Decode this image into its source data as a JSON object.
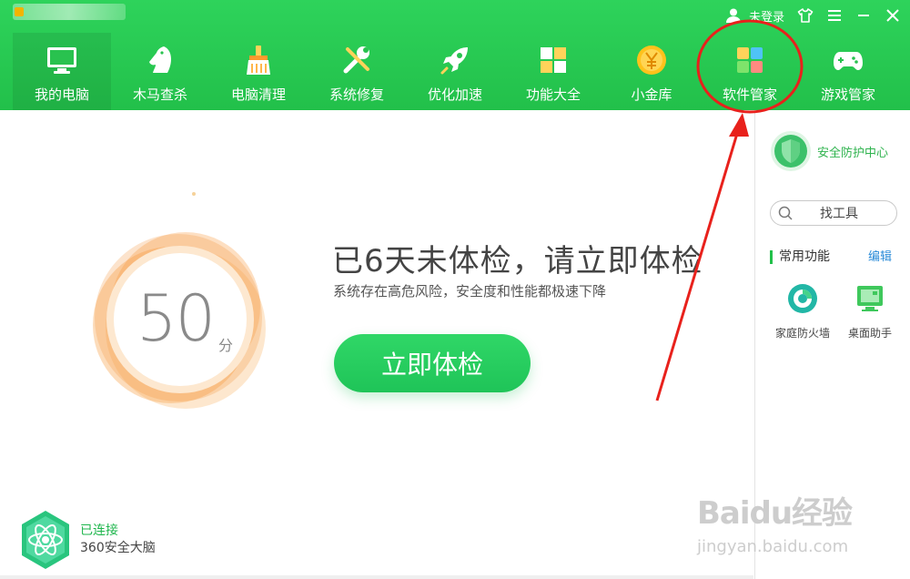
{
  "header": {
    "user_label": "未登录",
    "nav": [
      {
        "label": "我的电脑",
        "icon": "monitor-icon"
      },
      {
        "label": "木马查杀",
        "icon": "horse-icon"
      },
      {
        "label": "电脑清理",
        "icon": "broom-icon"
      },
      {
        "label": "系统修复",
        "icon": "wrench-icon"
      },
      {
        "label": "优化加速",
        "icon": "rocket-icon"
      },
      {
        "label": "功能大全",
        "icon": "grid-icon"
      },
      {
        "label": "小金库",
        "icon": "coin-icon"
      },
      {
        "label": "软件管家",
        "icon": "software-icon"
      },
      {
        "label": "游戏管家",
        "icon": "gamepad-icon"
      }
    ],
    "active_index": 0
  },
  "main": {
    "score": "50",
    "score_unit": "分",
    "headline": "已6天未体检，请立即体检",
    "subline": "系统存在高危风险，安全度和性能都极速下降",
    "check_button": "立即体检",
    "brain": {
      "status": "已连接",
      "name": "360安全大脑"
    }
  },
  "sidebar": {
    "security_center": "安全防护中心",
    "search_label": "找工具",
    "common_title": "常用功能",
    "edit_label": "编辑",
    "tools": [
      {
        "label": "家庭防火墙",
        "icon": "firewall-icon"
      },
      {
        "label": "桌面助手",
        "icon": "desktop-helper-icon"
      }
    ]
  },
  "watermark": {
    "line1": "Baidu经验",
    "line2": "jingyan.baidu.com"
  },
  "colors": {
    "brand_green": "#22c04a",
    "score_orange": "#f7943d",
    "annotation_red": "#e8211c",
    "link_blue": "#2a8bd8"
  }
}
